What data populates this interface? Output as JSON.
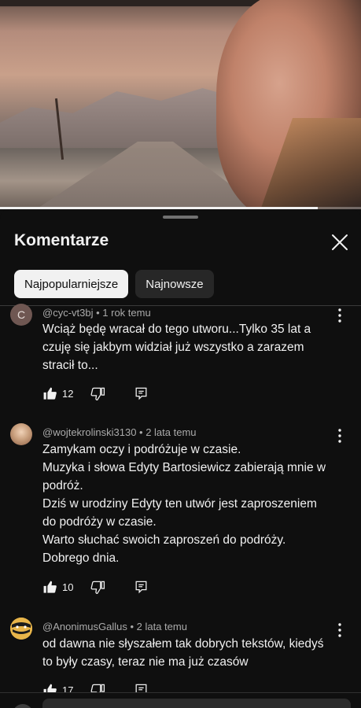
{
  "video": {
    "progress": 0.88
  },
  "sheet": {
    "title": "Komentarze",
    "close_icon": "close-icon",
    "chips": [
      {
        "label": "Najpopularniejsze",
        "active": true
      },
      {
        "label": "Najnowsze",
        "active": false
      }
    ]
  },
  "comments": [
    {
      "avatar_letter": "C",
      "avatar_color": "#6f5752",
      "author": "@cyc-vt3bj",
      "time": "1 rok temu",
      "lines": [
        "Wciąż będę wracał do tego utworu...Tylko 35 lat a",
        "czuję się jakbym widział już wszystko a zarazem",
        "stracił to..."
      ],
      "likes": "12"
    },
    {
      "avatar_letter": "",
      "avatar_color": "#c9a07e",
      "author": "@wojtekrolinski3130",
      "time": "2 lata temu",
      "lines": [
        "Zamykam oczy i podróżuje w czasie.",
        "Muzyka i słowa Edyty Bartosiewicz zabierają mnie w",
        "podróż.",
        "Dziś w urodziny Edyty ten utwór jest zaproszeniem",
        "do podróży w czasie.",
        "Warto słuchać swoich zaproszeń do podróży.",
        "Dobrego dnia."
      ],
      "likes": "10"
    },
    {
      "avatar_letter": "",
      "avatar_color": "#e8b54a",
      "author": "@AnonimusGallus",
      "time": "2 lata temu",
      "lines": [
        "od dawna nie słyszałem tak dobrych tekstów, kiedyś",
        "to były czasy, teraz nie ma już czasów"
      ],
      "likes": "17"
    }
  ],
  "icons": {
    "like": "thumb-up-icon",
    "dislike": "thumb-down-icon",
    "reply": "reply-icon",
    "more": "more-vert-icon"
  }
}
